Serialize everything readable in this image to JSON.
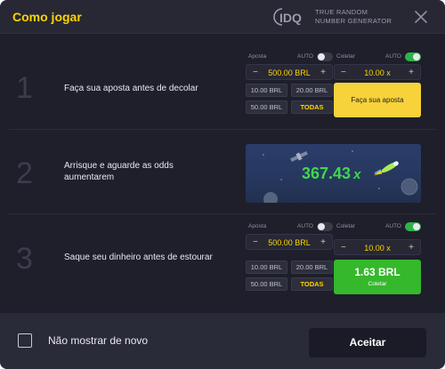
{
  "header": {
    "title": "Como jogar",
    "brand_logo": "IDQ",
    "brand_tagline_line1": "TRUE RANDOM",
    "brand_tagline_line2": "NUMBER GENERATOR",
    "close_icon": "close-icon"
  },
  "steps": [
    {
      "number": "1",
      "text": "Faça sua aposta antes de decolar"
    },
    {
      "number": "2",
      "text_line1": "Arrisque e aguarde as odds",
      "text_line2": "aumentarem"
    },
    {
      "number": "3",
      "text": "Saque seu dinheiro antes de estourar"
    }
  ],
  "bet_panel_1": {
    "left": {
      "label": "Aposta",
      "auto_label": "AUTO",
      "auto_enabled": false,
      "minus": "−",
      "plus": "+",
      "value": "500.00 BRL",
      "chips": [
        "10.00 BRL",
        "20.00 BRL",
        "50.00 BRL",
        "TODAS"
      ]
    },
    "right": {
      "label": "Coletar",
      "auto_label": "AUTO",
      "auto_enabled": true,
      "minus": "−",
      "plus": "+",
      "value": "10.00 x",
      "button_label": "Faça sua aposta"
    }
  },
  "game_preview": {
    "multiplier": "367.43",
    "multiplier_suffix": "x"
  },
  "bet_panel_3": {
    "left": {
      "label": "Aposta",
      "auto_label": "AUTO",
      "auto_enabled": false,
      "minus": "−",
      "plus": "+",
      "value": "500.00 BRL",
      "chips": [
        "10.00 BRL",
        "20.00 BRL",
        "50.00 BRL",
        "TODAS"
      ]
    },
    "right": {
      "label": "Coletar",
      "auto_label": "AUTO",
      "auto_enabled": true,
      "minus": "−",
      "plus": "+",
      "value": "10.00 x",
      "cashout_amount": "1.63 BRL",
      "cashout_label": "Coletar"
    }
  },
  "footer": {
    "checkbox_label": "Não mostrar de novo",
    "checkbox_checked": false,
    "accept_label": "Aceitar"
  },
  "colors": {
    "accent_yellow": "#ffd400",
    "bet_button": "#f7d23a",
    "cashout_green": "#35b82c",
    "multiplier_green": "#3fd84b",
    "background": "#1e1f2b"
  }
}
